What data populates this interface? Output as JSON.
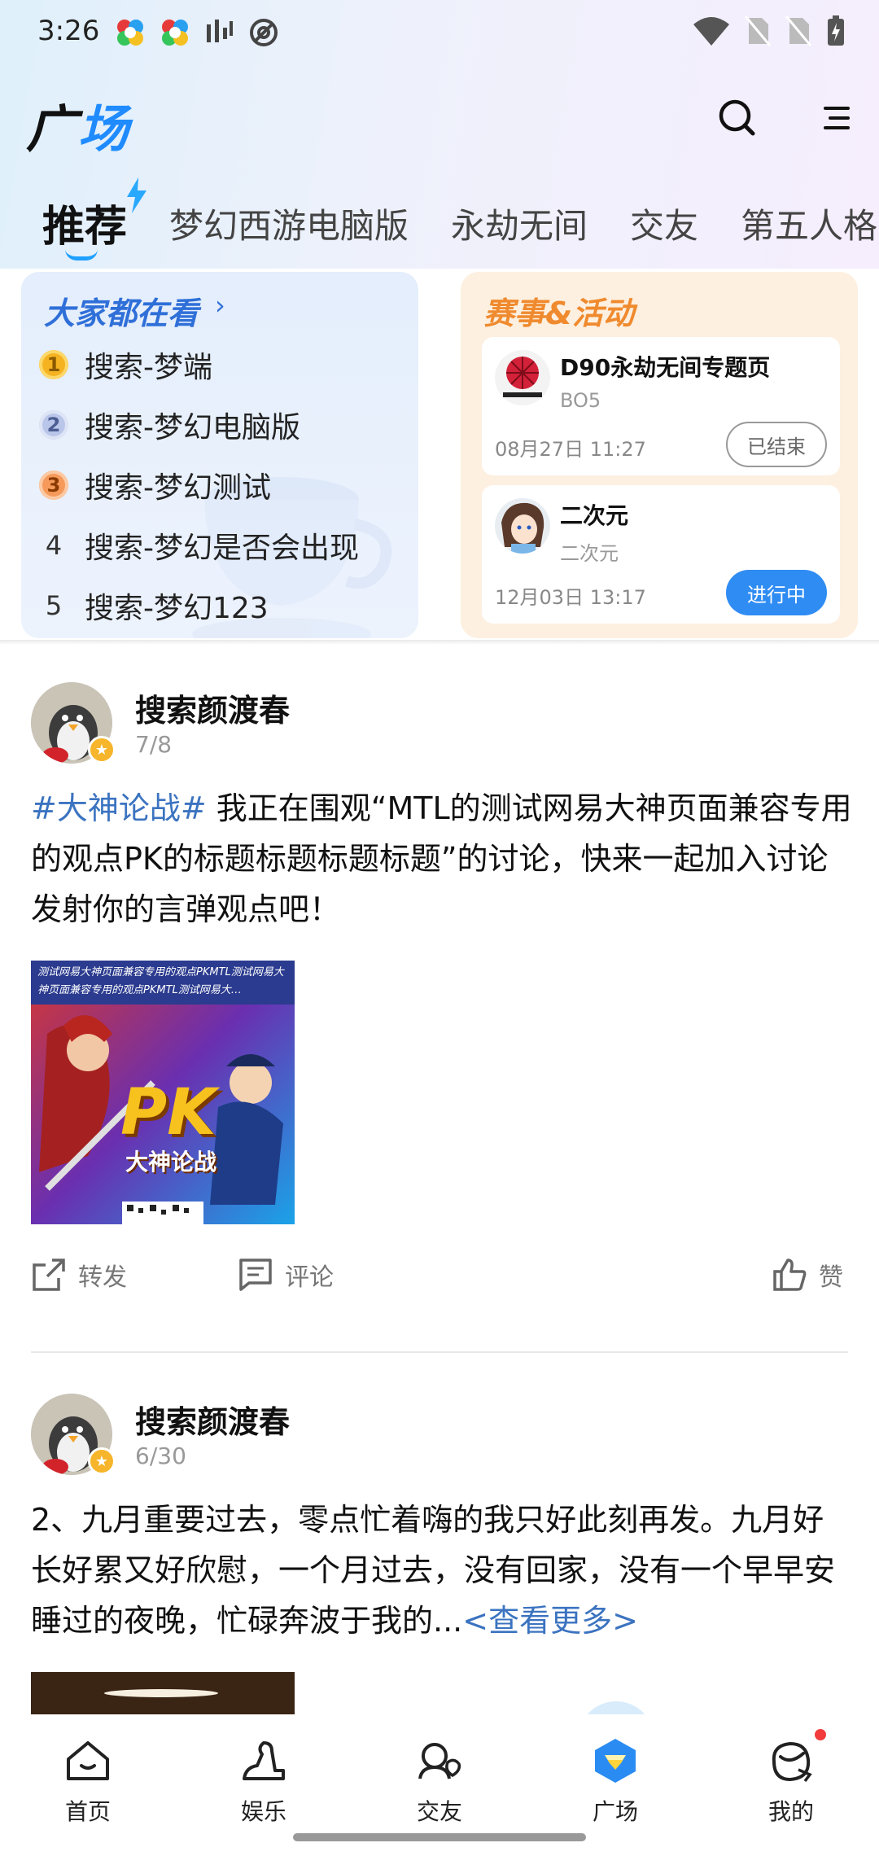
{
  "status_bar": {
    "time": "3:26"
  },
  "header": {
    "title_part1": "广",
    "title_part2": "场"
  },
  "tabs": [
    {
      "label": "推荐",
      "active": true
    },
    {
      "label": "梦幻西游电脑版"
    },
    {
      "label": "永劫无间"
    },
    {
      "label": "交友"
    },
    {
      "label": "第五人格"
    }
  ],
  "hot": {
    "title": "大家都在看",
    "chevron": "›",
    "items": [
      {
        "rank": "1",
        "text": "搜索-梦端"
      },
      {
        "rank": "2",
        "text": "搜索-梦幻电脑版"
      },
      {
        "rank": "3",
        "text": "搜索-梦幻测试"
      },
      {
        "rank": "4",
        "text": "搜索-梦幻是否会出现"
      },
      {
        "rank": "5",
        "text": "搜索-梦幻123"
      }
    ]
  },
  "events": {
    "title": "赛事&活动",
    "items": [
      {
        "name": "D90永劫无间专题页",
        "sub": "BO5",
        "time": "08月27日 11:27",
        "status": "已结束"
      },
      {
        "name": "二次元",
        "sub": "二次元",
        "time": "12月03日 13:17",
        "status": "进行中"
      }
    ]
  },
  "posts": [
    {
      "author": "搜索颜渡春",
      "date": "7/8",
      "topic": "#大神论战#",
      "text": " 我正在围观“MTL的测试网易大神页面兼容专用的观点PK的标题标题标题标题”的讨论，快来一起加入讨论发射你的言弹观点吧！",
      "image_banner": "测试网易大神页面兼容专用的观点PKMTL测试网易大神页面兼容专用的观点PKMTL测试网易大…",
      "image_logo": "PK",
      "image_sub": "大神论战",
      "actions": {
        "share": "转发",
        "comment": "评论",
        "like": "赞"
      }
    },
    {
      "author": "搜索颜渡春",
      "date": "6/30",
      "text": "2、九月重要过去，零点忙着嗨的我只好此刻再发。九月好长好累又好欣慰，一个月过去，没有回家，没有一个早早安睡过的夜晚，忙碌奔波于我的...",
      "more": "<查看更多>"
    }
  ],
  "bottom_nav": [
    {
      "label": "首页"
    },
    {
      "label": "娱乐"
    },
    {
      "label": "交友"
    },
    {
      "label": "广场",
      "active": true
    },
    {
      "label": "我的"
    }
  ],
  "colors": {
    "accent": "#1f8bff",
    "link": "#3b73c0",
    "event_orange": "#f08a2e",
    "live_blue": "#2f8cf3"
  }
}
